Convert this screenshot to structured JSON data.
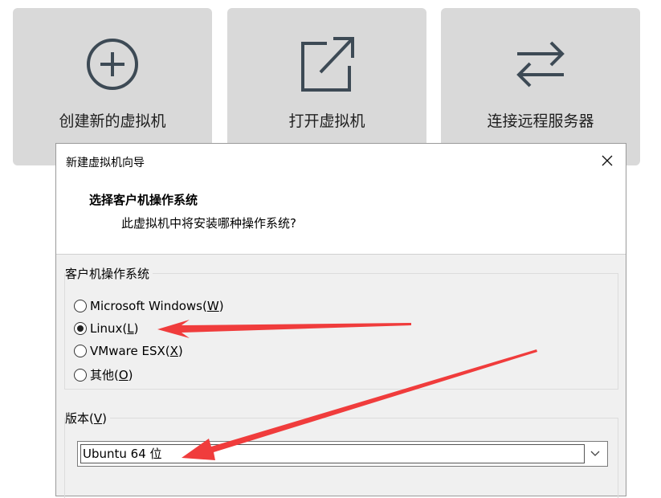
{
  "tiles": [
    {
      "label": "创建新的虚拟机",
      "icon": "plus-circle-icon"
    },
    {
      "label": "打开虚拟机",
      "icon": "open-external-icon"
    },
    {
      "label": "连接远程服务器",
      "icon": "swap-arrows-icon"
    }
  ],
  "dialog": {
    "title": "新建虚拟机向导",
    "close_icon": "close-icon",
    "heading": "选择客户机操作系统",
    "subheading": "此虚拟机中将安装哪种操作系统?",
    "os_group": {
      "label": "客户机操作系统",
      "options": [
        {
          "text": "Microsoft Windows(",
          "key": "W",
          "suffix": ")",
          "checked": false
        },
        {
          "text": "Linux(",
          "key": "L",
          "suffix": ")",
          "checked": true
        },
        {
          "text": "VMware ESX(",
          "key": "X",
          "suffix": ")",
          "checked": false
        },
        {
          "text": "其他(",
          "key": "O",
          "suffix": ")",
          "checked": false
        }
      ]
    },
    "version_group": {
      "label_text": "版本(",
      "label_key": "V",
      "label_suffix": ")",
      "selected": "Ubuntu 64 位"
    }
  },
  "annotation_color": "#f03c3c"
}
